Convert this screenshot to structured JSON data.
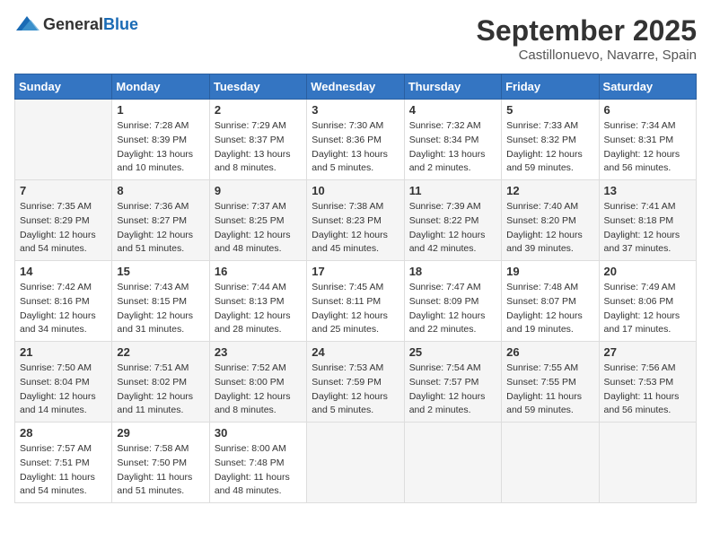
{
  "header": {
    "logo_general": "General",
    "logo_blue": "Blue",
    "month_title": "September 2025",
    "location": "Castillonuevo, Navarre, Spain"
  },
  "weekdays": [
    "Sunday",
    "Monday",
    "Tuesday",
    "Wednesday",
    "Thursday",
    "Friday",
    "Saturday"
  ],
  "weeks": [
    [
      {
        "day": "",
        "sunrise": "",
        "sunset": "",
        "daylight": ""
      },
      {
        "day": "1",
        "sunrise": "Sunrise: 7:28 AM",
        "sunset": "Sunset: 8:39 PM",
        "daylight": "Daylight: 13 hours and 10 minutes."
      },
      {
        "day": "2",
        "sunrise": "Sunrise: 7:29 AM",
        "sunset": "Sunset: 8:37 PM",
        "daylight": "Daylight: 13 hours and 8 minutes."
      },
      {
        "day": "3",
        "sunrise": "Sunrise: 7:30 AM",
        "sunset": "Sunset: 8:36 PM",
        "daylight": "Daylight: 13 hours and 5 minutes."
      },
      {
        "day": "4",
        "sunrise": "Sunrise: 7:32 AM",
        "sunset": "Sunset: 8:34 PM",
        "daylight": "Daylight: 13 hours and 2 minutes."
      },
      {
        "day": "5",
        "sunrise": "Sunrise: 7:33 AM",
        "sunset": "Sunset: 8:32 PM",
        "daylight": "Daylight: 12 hours and 59 minutes."
      },
      {
        "day": "6",
        "sunrise": "Sunrise: 7:34 AM",
        "sunset": "Sunset: 8:31 PM",
        "daylight": "Daylight: 12 hours and 56 minutes."
      }
    ],
    [
      {
        "day": "7",
        "sunrise": "Sunrise: 7:35 AM",
        "sunset": "Sunset: 8:29 PM",
        "daylight": "Daylight: 12 hours and 54 minutes."
      },
      {
        "day": "8",
        "sunrise": "Sunrise: 7:36 AM",
        "sunset": "Sunset: 8:27 PM",
        "daylight": "Daylight: 12 hours and 51 minutes."
      },
      {
        "day": "9",
        "sunrise": "Sunrise: 7:37 AM",
        "sunset": "Sunset: 8:25 PM",
        "daylight": "Daylight: 12 hours and 48 minutes."
      },
      {
        "day": "10",
        "sunrise": "Sunrise: 7:38 AM",
        "sunset": "Sunset: 8:23 PM",
        "daylight": "Daylight: 12 hours and 45 minutes."
      },
      {
        "day": "11",
        "sunrise": "Sunrise: 7:39 AM",
        "sunset": "Sunset: 8:22 PM",
        "daylight": "Daylight: 12 hours and 42 minutes."
      },
      {
        "day": "12",
        "sunrise": "Sunrise: 7:40 AM",
        "sunset": "Sunset: 8:20 PM",
        "daylight": "Daylight: 12 hours and 39 minutes."
      },
      {
        "day": "13",
        "sunrise": "Sunrise: 7:41 AM",
        "sunset": "Sunset: 8:18 PM",
        "daylight": "Daylight: 12 hours and 37 minutes."
      }
    ],
    [
      {
        "day": "14",
        "sunrise": "Sunrise: 7:42 AM",
        "sunset": "Sunset: 8:16 PM",
        "daylight": "Daylight: 12 hours and 34 minutes."
      },
      {
        "day": "15",
        "sunrise": "Sunrise: 7:43 AM",
        "sunset": "Sunset: 8:15 PM",
        "daylight": "Daylight: 12 hours and 31 minutes."
      },
      {
        "day": "16",
        "sunrise": "Sunrise: 7:44 AM",
        "sunset": "Sunset: 8:13 PM",
        "daylight": "Daylight: 12 hours and 28 minutes."
      },
      {
        "day": "17",
        "sunrise": "Sunrise: 7:45 AM",
        "sunset": "Sunset: 8:11 PM",
        "daylight": "Daylight: 12 hours and 25 minutes."
      },
      {
        "day": "18",
        "sunrise": "Sunrise: 7:47 AM",
        "sunset": "Sunset: 8:09 PM",
        "daylight": "Daylight: 12 hours and 22 minutes."
      },
      {
        "day": "19",
        "sunrise": "Sunrise: 7:48 AM",
        "sunset": "Sunset: 8:07 PM",
        "daylight": "Daylight: 12 hours and 19 minutes."
      },
      {
        "day": "20",
        "sunrise": "Sunrise: 7:49 AM",
        "sunset": "Sunset: 8:06 PM",
        "daylight": "Daylight: 12 hours and 17 minutes."
      }
    ],
    [
      {
        "day": "21",
        "sunrise": "Sunrise: 7:50 AM",
        "sunset": "Sunset: 8:04 PM",
        "daylight": "Daylight: 12 hours and 14 minutes."
      },
      {
        "day": "22",
        "sunrise": "Sunrise: 7:51 AM",
        "sunset": "Sunset: 8:02 PM",
        "daylight": "Daylight: 12 hours and 11 minutes."
      },
      {
        "day": "23",
        "sunrise": "Sunrise: 7:52 AM",
        "sunset": "Sunset: 8:00 PM",
        "daylight": "Daylight: 12 hours and 8 minutes."
      },
      {
        "day": "24",
        "sunrise": "Sunrise: 7:53 AM",
        "sunset": "Sunset: 7:59 PM",
        "daylight": "Daylight: 12 hours and 5 minutes."
      },
      {
        "day": "25",
        "sunrise": "Sunrise: 7:54 AM",
        "sunset": "Sunset: 7:57 PM",
        "daylight": "Daylight: 12 hours and 2 minutes."
      },
      {
        "day": "26",
        "sunrise": "Sunrise: 7:55 AM",
        "sunset": "Sunset: 7:55 PM",
        "daylight": "Daylight: 11 hours and 59 minutes."
      },
      {
        "day": "27",
        "sunrise": "Sunrise: 7:56 AM",
        "sunset": "Sunset: 7:53 PM",
        "daylight": "Daylight: 11 hours and 56 minutes."
      }
    ],
    [
      {
        "day": "28",
        "sunrise": "Sunrise: 7:57 AM",
        "sunset": "Sunset: 7:51 PM",
        "daylight": "Daylight: 11 hours and 54 minutes."
      },
      {
        "day": "29",
        "sunrise": "Sunrise: 7:58 AM",
        "sunset": "Sunset: 7:50 PM",
        "daylight": "Daylight: 11 hours and 51 minutes."
      },
      {
        "day": "30",
        "sunrise": "Sunrise: 8:00 AM",
        "sunset": "Sunset: 7:48 PM",
        "daylight": "Daylight: 11 hours and 48 minutes."
      },
      {
        "day": "",
        "sunrise": "",
        "sunset": "",
        "daylight": ""
      },
      {
        "day": "",
        "sunrise": "",
        "sunset": "",
        "daylight": ""
      },
      {
        "day": "",
        "sunrise": "",
        "sunset": "",
        "daylight": ""
      },
      {
        "day": "",
        "sunrise": "",
        "sunset": "",
        "daylight": ""
      }
    ]
  ]
}
